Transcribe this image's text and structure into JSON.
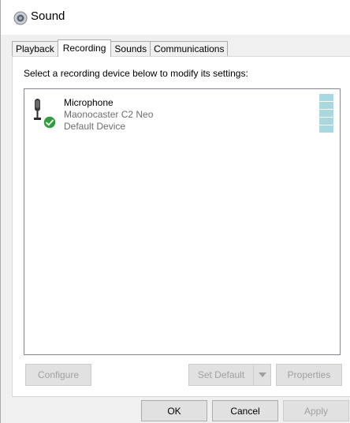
{
  "window": {
    "title": "Sound"
  },
  "tabs": [
    {
      "label": "Playback"
    },
    {
      "label": "Recording"
    },
    {
      "label": "Sounds"
    },
    {
      "label": "Communications"
    }
  ],
  "panel": {
    "instruction": "Select a recording device below to modify its settings:",
    "devices": [
      {
        "name": "Microphone",
        "model": "Maonocaster C2 Neo",
        "status": "Default Device",
        "icon": "microphone-icon",
        "badge": "default-check-icon"
      }
    ],
    "buttons": {
      "configure": "Configure",
      "set_default": "Set Default",
      "properties": "Properties"
    }
  },
  "footer": {
    "ok": "OK",
    "cancel": "Cancel",
    "apply": "Apply"
  },
  "colors": {
    "level_meter": "#a8d8e0",
    "check_badge": "#2e9e3e",
    "selected_tab_bg": "#ffffff"
  }
}
